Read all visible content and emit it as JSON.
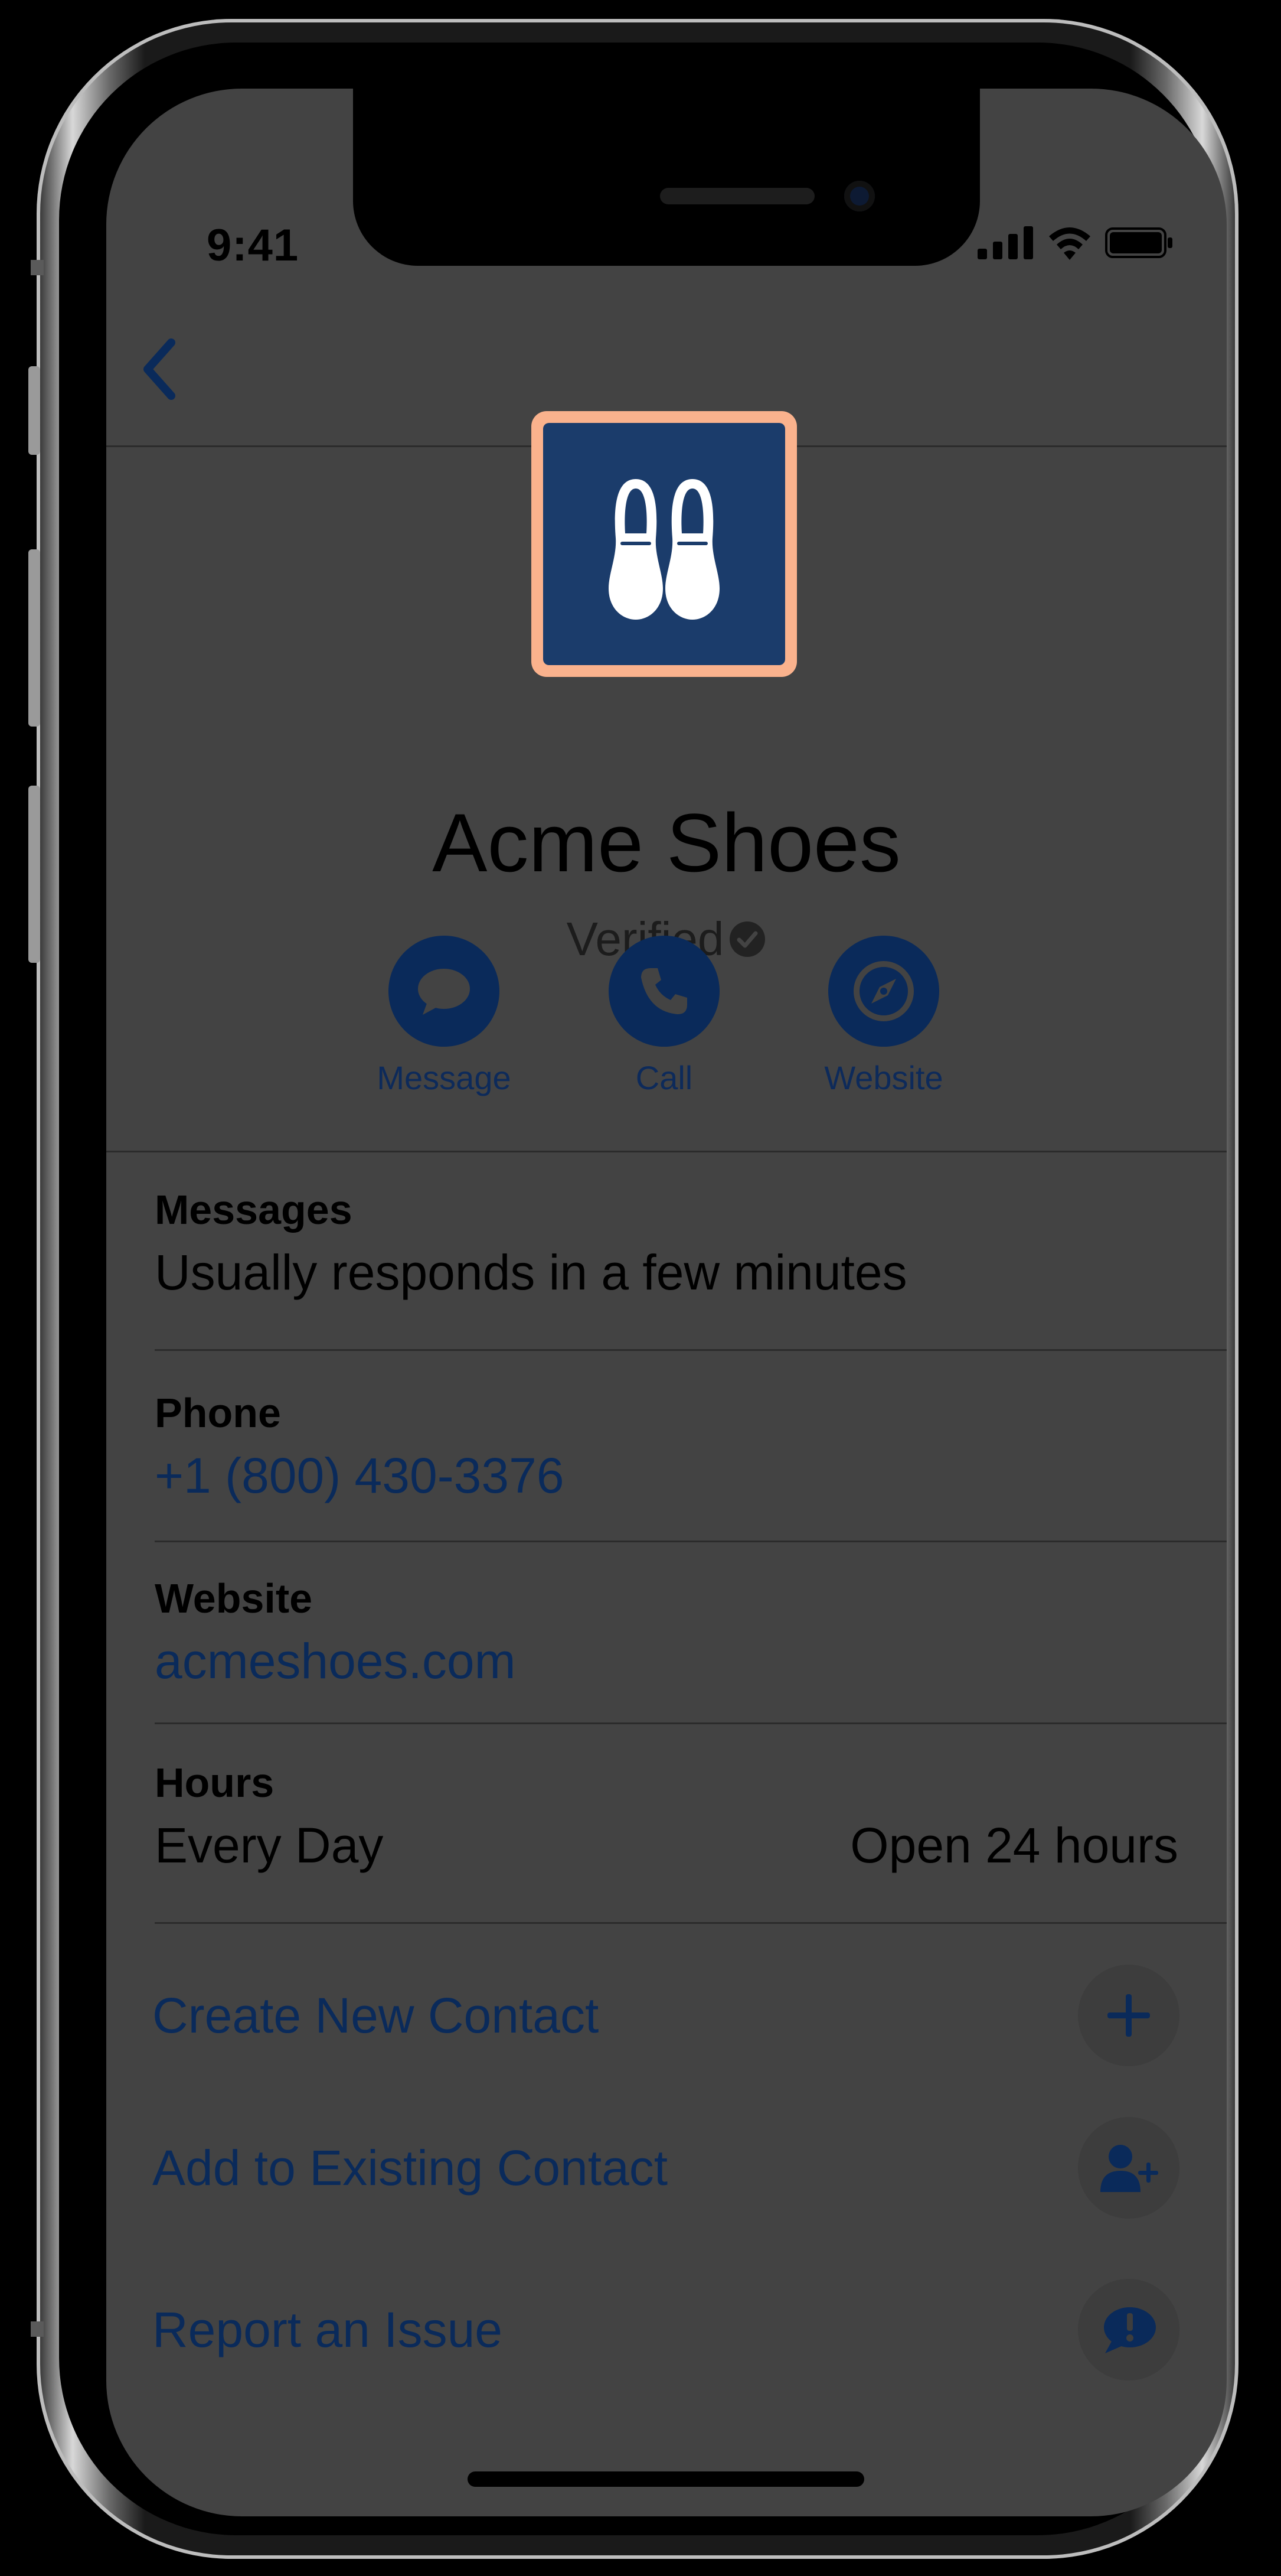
{
  "status_bar": {
    "time": "9:41"
  },
  "header": {
    "business_name": "Acme Shoes",
    "verified_label": "Verified",
    "logo_icon": "shoes-icon",
    "logo_border_color": "#fab28d",
    "logo_bg_color": "#1b3c6b"
  },
  "actions": [
    {
      "label": "Message",
      "icon": "message-bubble-icon"
    },
    {
      "label": "Call",
      "icon": "phone-icon"
    },
    {
      "label": "Website",
      "icon": "compass-icon"
    }
  ],
  "info": {
    "messages": {
      "label": "Messages",
      "value": "Usually responds in a few minutes"
    },
    "phone": {
      "label": "Phone",
      "value": "+1 (800) 430-3376"
    },
    "website": {
      "label": "Website",
      "value": "acmeshoes.com"
    },
    "hours": {
      "label": "Hours",
      "day": "Every Day",
      "time": "Open 24 hours"
    }
  },
  "list_actions": [
    {
      "label": "Create New Contact",
      "icon": "plus-icon"
    },
    {
      "label": "Add to Existing Contact",
      "icon": "add-person-icon"
    },
    {
      "label": "Report an Issue",
      "icon": "exclamation-bubble-icon"
    }
  ],
  "colors": {
    "accent": "#0a2a5a",
    "screen_bg": "#434343"
  }
}
